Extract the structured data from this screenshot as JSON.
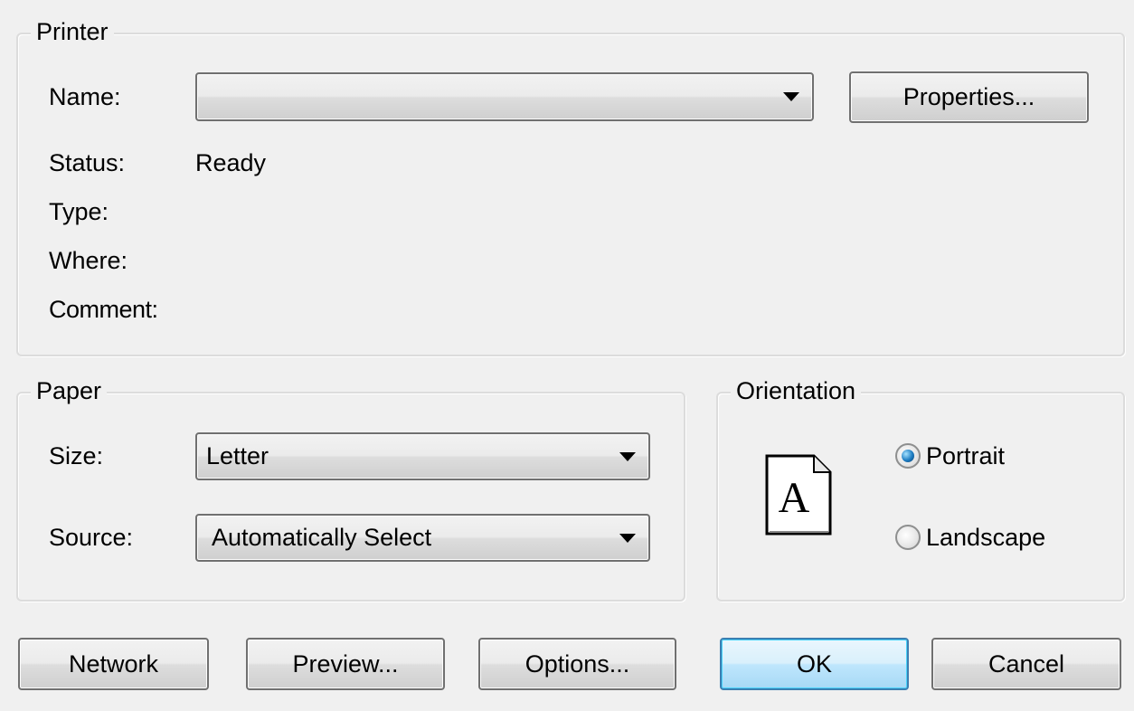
{
  "printer": {
    "title": "Printer",
    "name_label": "Name:",
    "name_value": "",
    "properties_button": "Properties...",
    "status_label": "Status:",
    "status_value": "Ready",
    "type_label": "Type:",
    "where_label": "Where:",
    "comment_label": "Comment:"
  },
  "paper": {
    "title": "Paper",
    "size_label": "Size:",
    "size_value": "Letter",
    "source_label": "Source:",
    "source_value": "Automatically Select"
  },
  "orientation": {
    "title": "Orientation",
    "icon_letter": "A",
    "portrait_label": "Portrait",
    "landscape_label": "Landscape",
    "selected": "portrait"
  },
  "buttons": {
    "network": "Network",
    "preview": "Preview...",
    "options": "Options...",
    "ok": "OK",
    "cancel": "Cancel"
  },
  "colors": {
    "background": "#f0f0f0",
    "default_button_border": "#3c7fb1",
    "radio_selected": "#1c7cc2"
  }
}
